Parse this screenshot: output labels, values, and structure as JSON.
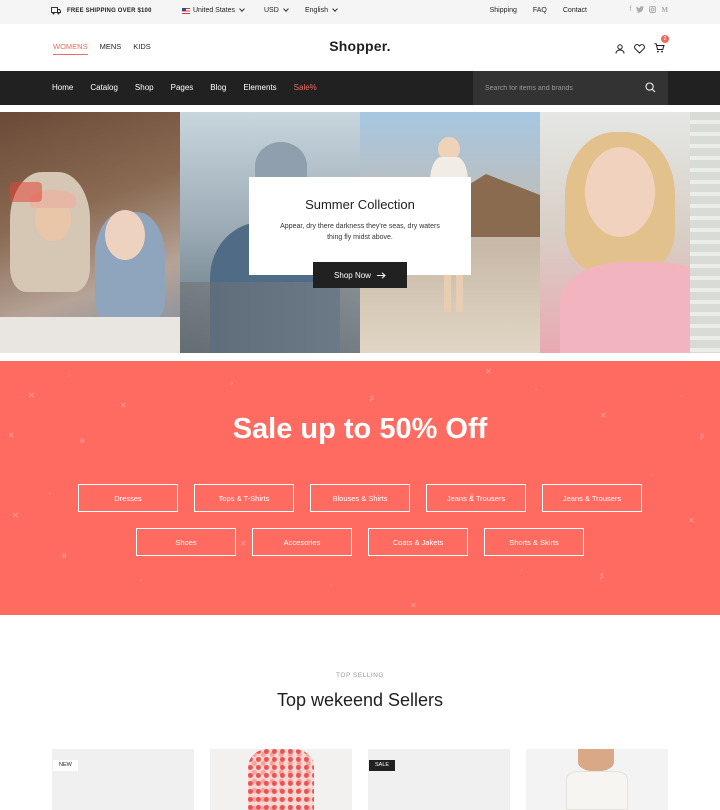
{
  "topbar": {
    "shipping": "FREE SHIPPING OVER $100",
    "country": "United States",
    "currency": "USD",
    "language": "English",
    "links": [
      "Shipping",
      "FAQ",
      "Contact"
    ],
    "social_icons": [
      "facebook-icon",
      "twitter-icon",
      "instagram-icon",
      "medium-icon"
    ]
  },
  "header": {
    "categories": [
      "WOMENS",
      "MENS",
      "KIDS"
    ],
    "active_category": "WOMENS",
    "logo": "Shopper.",
    "cart_count": "2"
  },
  "nav": {
    "items": [
      "Home",
      "Catalog",
      "Shop",
      "Pages",
      "Blog",
      "Elements",
      "Sale%"
    ],
    "search_placeholder": "Search for items and brands"
  },
  "hero": {
    "title": "Summer Collection",
    "text": "Appear, dry there darkness they're seas, dry waters thing fly midst above.",
    "button": "Shop Now"
  },
  "sale": {
    "title": "Sale up to 50% Off",
    "row1": [
      "Dresses",
      "Tops & T-Shirts",
      "Blouses & Shirts",
      "Jeans & Trousers",
      "Jeans & Trousers"
    ],
    "row2": [
      "Shoes",
      "Accesories",
      "Coats & Jakets",
      "Shorts & Skirts"
    ]
  },
  "sellers": {
    "kicker": "TOP SELLING",
    "title": "Top wekeend Sellers",
    "tags": [
      "NEW",
      "",
      "SALE",
      ""
    ]
  },
  "colors": {
    "accent": "#ff6b61",
    "dark": "#212121"
  }
}
